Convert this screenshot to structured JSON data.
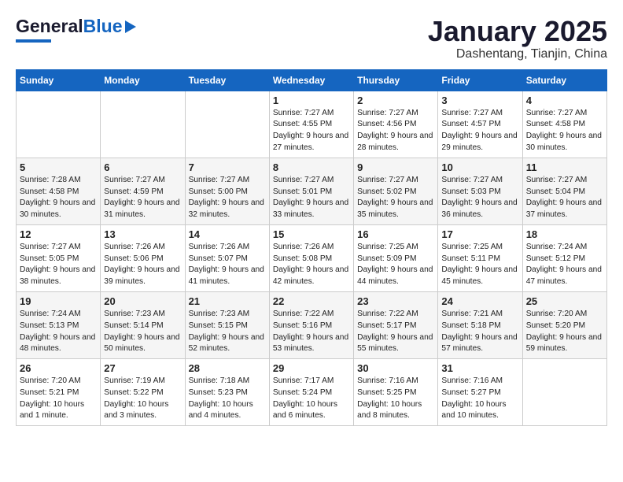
{
  "header": {
    "logo_general": "General",
    "logo_blue": "Blue",
    "month": "January 2025",
    "location": "Dashentang, Tianjin, China"
  },
  "days_of_week": [
    "Sunday",
    "Monday",
    "Tuesday",
    "Wednesday",
    "Thursday",
    "Friday",
    "Saturday"
  ],
  "weeks": [
    [
      {
        "day": "",
        "text": ""
      },
      {
        "day": "",
        "text": ""
      },
      {
        "day": "",
        "text": ""
      },
      {
        "day": "1",
        "text": "Sunrise: 7:27 AM\nSunset: 4:55 PM\nDaylight: 9 hours and 27 minutes."
      },
      {
        "day": "2",
        "text": "Sunrise: 7:27 AM\nSunset: 4:56 PM\nDaylight: 9 hours and 28 minutes."
      },
      {
        "day": "3",
        "text": "Sunrise: 7:27 AM\nSunset: 4:57 PM\nDaylight: 9 hours and 29 minutes."
      },
      {
        "day": "4",
        "text": "Sunrise: 7:27 AM\nSunset: 4:58 PM\nDaylight: 9 hours and 30 minutes."
      }
    ],
    [
      {
        "day": "5",
        "text": "Sunrise: 7:28 AM\nSunset: 4:58 PM\nDaylight: 9 hours and 30 minutes."
      },
      {
        "day": "6",
        "text": "Sunrise: 7:27 AM\nSunset: 4:59 PM\nDaylight: 9 hours and 31 minutes."
      },
      {
        "day": "7",
        "text": "Sunrise: 7:27 AM\nSunset: 5:00 PM\nDaylight: 9 hours and 32 minutes."
      },
      {
        "day": "8",
        "text": "Sunrise: 7:27 AM\nSunset: 5:01 PM\nDaylight: 9 hours and 33 minutes."
      },
      {
        "day": "9",
        "text": "Sunrise: 7:27 AM\nSunset: 5:02 PM\nDaylight: 9 hours and 35 minutes."
      },
      {
        "day": "10",
        "text": "Sunrise: 7:27 AM\nSunset: 5:03 PM\nDaylight: 9 hours and 36 minutes."
      },
      {
        "day": "11",
        "text": "Sunrise: 7:27 AM\nSunset: 5:04 PM\nDaylight: 9 hours and 37 minutes."
      }
    ],
    [
      {
        "day": "12",
        "text": "Sunrise: 7:27 AM\nSunset: 5:05 PM\nDaylight: 9 hours and 38 minutes."
      },
      {
        "day": "13",
        "text": "Sunrise: 7:26 AM\nSunset: 5:06 PM\nDaylight: 9 hours and 39 minutes."
      },
      {
        "day": "14",
        "text": "Sunrise: 7:26 AM\nSunset: 5:07 PM\nDaylight: 9 hours and 41 minutes."
      },
      {
        "day": "15",
        "text": "Sunrise: 7:26 AM\nSunset: 5:08 PM\nDaylight: 9 hours and 42 minutes."
      },
      {
        "day": "16",
        "text": "Sunrise: 7:25 AM\nSunset: 5:09 PM\nDaylight: 9 hours and 44 minutes."
      },
      {
        "day": "17",
        "text": "Sunrise: 7:25 AM\nSunset: 5:11 PM\nDaylight: 9 hours and 45 minutes."
      },
      {
        "day": "18",
        "text": "Sunrise: 7:24 AM\nSunset: 5:12 PM\nDaylight: 9 hours and 47 minutes."
      }
    ],
    [
      {
        "day": "19",
        "text": "Sunrise: 7:24 AM\nSunset: 5:13 PM\nDaylight: 9 hours and 48 minutes."
      },
      {
        "day": "20",
        "text": "Sunrise: 7:23 AM\nSunset: 5:14 PM\nDaylight: 9 hours and 50 minutes."
      },
      {
        "day": "21",
        "text": "Sunrise: 7:23 AM\nSunset: 5:15 PM\nDaylight: 9 hours and 52 minutes."
      },
      {
        "day": "22",
        "text": "Sunrise: 7:22 AM\nSunset: 5:16 PM\nDaylight: 9 hours and 53 minutes."
      },
      {
        "day": "23",
        "text": "Sunrise: 7:22 AM\nSunset: 5:17 PM\nDaylight: 9 hours and 55 minutes."
      },
      {
        "day": "24",
        "text": "Sunrise: 7:21 AM\nSunset: 5:18 PM\nDaylight: 9 hours and 57 minutes."
      },
      {
        "day": "25",
        "text": "Sunrise: 7:20 AM\nSunset: 5:20 PM\nDaylight: 9 hours and 59 minutes."
      }
    ],
    [
      {
        "day": "26",
        "text": "Sunrise: 7:20 AM\nSunset: 5:21 PM\nDaylight: 10 hours and 1 minute."
      },
      {
        "day": "27",
        "text": "Sunrise: 7:19 AM\nSunset: 5:22 PM\nDaylight: 10 hours and 3 minutes."
      },
      {
        "day": "28",
        "text": "Sunrise: 7:18 AM\nSunset: 5:23 PM\nDaylight: 10 hours and 4 minutes."
      },
      {
        "day": "29",
        "text": "Sunrise: 7:17 AM\nSunset: 5:24 PM\nDaylight: 10 hours and 6 minutes."
      },
      {
        "day": "30",
        "text": "Sunrise: 7:16 AM\nSunset: 5:25 PM\nDaylight: 10 hours and 8 minutes."
      },
      {
        "day": "31",
        "text": "Sunrise: 7:16 AM\nSunset: 5:27 PM\nDaylight: 10 hours and 10 minutes."
      },
      {
        "day": "",
        "text": ""
      }
    ]
  ]
}
